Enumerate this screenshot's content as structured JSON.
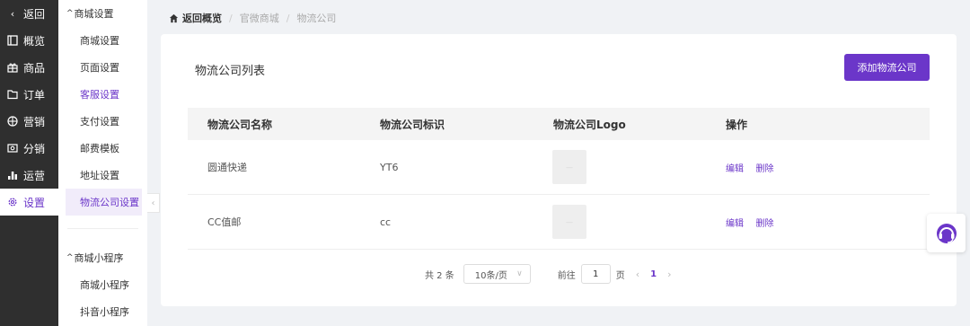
{
  "nav": {
    "back": "返回",
    "items": [
      "概览",
      "商品",
      "订单",
      "营销",
      "分销",
      "运营",
      "设置"
    ]
  },
  "submenu": {
    "group1": "商城设置",
    "items": [
      "商城设置",
      "页面设置",
      "客服设置",
      "支付设置",
      "邮费模板",
      "地址设置",
      "物流公司设置"
    ],
    "group2": "商城小程序",
    "items2": [
      "商城小程序",
      "抖音小程序"
    ]
  },
  "breadcrumb": {
    "home": "返回概览",
    "c1": "官微商城",
    "c2": "物流公司"
  },
  "card": {
    "title": "物流公司列表",
    "add_button": "添加物流公司"
  },
  "table": {
    "headers": [
      "物流公司名称",
      "物流公司标识",
      "物流公司Logo",
      "操作"
    ],
    "rows": [
      {
        "name": "圆通快递",
        "code": "YT6",
        "edit": "编辑",
        "delete": "删除"
      },
      {
        "name": "CC值邮",
        "code": "cc",
        "edit": "编辑",
        "delete": "删除"
      }
    ]
  },
  "pager": {
    "total": "共 2 条",
    "size": "10条/页",
    "goto": "前往",
    "page_input": "1",
    "page_unit": "页",
    "current": "1"
  },
  "colors": {
    "accent": "#6b36c9",
    "nav_bg": "#2f2f2f"
  }
}
